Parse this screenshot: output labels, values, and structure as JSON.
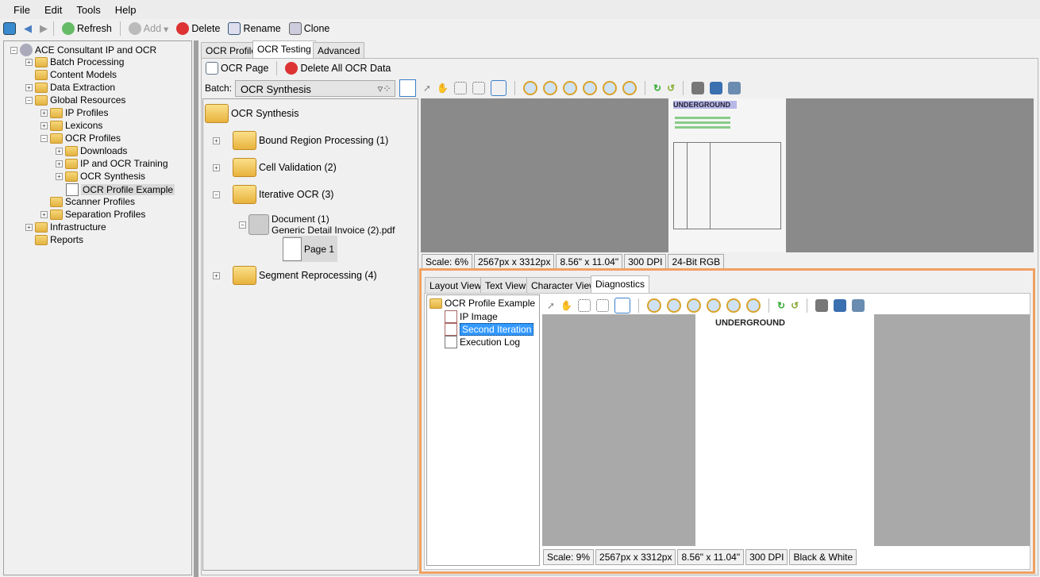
{
  "menu": [
    "File",
    "Edit",
    "Tools",
    "Help"
  ],
  "toolbar": {
    "refresh": "Refresh",
    "add": "Add",
    "delete": "Delete",
    "rename": "Rename",
    "clone": "Clone"
  },
  "left_tree": {
    "root": "ACE Consultant IP and OCR",
    "items": [
      "Batch Processing",
      "Content Models",
      "Data Extraction",
      "Global Resources",
      "IP Profiles",
      "Lexicons",
      "OCR Profiles",
      "Downloads",
      "IP and OCR Training",
      "OCR Synthesis",
      "OCR Profile Example",
      "Scanner Profiles",
      "Separation Profiles",
      "Infrastructure",
      "Reports"
    ]
  },
  "tabs": [
    "OCR Profile",
    "OCR Testing",
    "Advanced"
  ],
  "ocr_toolbar": {
    "ocr_page": "OCR Page",
    "delete_all": "Delete All OCR Data"
  },
  "batch": {
    "label": "Batch:",
    "value": "OCR Synthesis"
  },
  "batch_tree": {
    "root": "OCR Synthesis",
    "items": [
      "Bound Region Processing (1)",
      "Cell Validation (2)",
      "Iterative OCR (3)",
      "Segment Reprocessing (4)"
    ],
    "document": "Document (1)",
    "document_file": "Generic Detail Invoice (2).pdf",
    "page": "Page 1"
  },
  "viewer_status": [
    "Scale: 6%",
    "2567px x 3312px",
    "8.56\" x 11.04\"",
    "300 DPI",
    "24-Bit RGB"
  ],
  "diag_tabs": [
    "Layout View",
    "Text View",
    "Character View",
    "Diagnostics"
  ],
  "diag_tree": {
    "root": "OCR Profile Example",
    "items": [
      "IP Image",
      "Second Iteration",
      "Execution Log"
    ]
  },
  "diag_status": [
    "Scale: 9%",
    "2567px x 3312px",
    "8.56\" x 11.04\"",
    "300 DPI",
    "Black & White"
  ],
  "doc_logo": "UNDERGROUND",
  "colors": {
    "highlight": "#3399ff",
    "orange_border": "#f0a060"
  }
}
